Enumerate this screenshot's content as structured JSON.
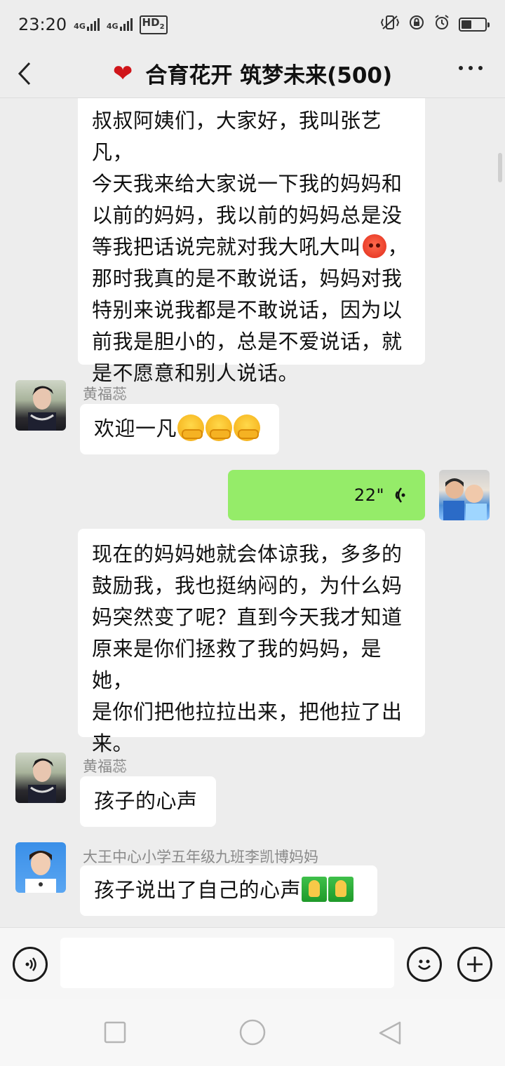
{
  "status_bar": {
    "time": "23:20",
    "network1": "4G",
    "network2": "4G",
    "hd": "HD",
    "hd_sub": "2",
    "battery_level": 0.4
  },
  "header": {
    "title": "合育花开 筑梦未来(500)",
    "heart": "❤"
  },
  "messages": {
    "m1": {
      "line1": "叔叔阿姨们，大家好，我叫张艺凡，",
      "line2": "今天我来给大家说一下我的妈妈和",
      "line3": "以前的妈妈，我以前的妈妈总是没",
      "line4a": "等我把话说完就对我大吼大叫",
      "line4b": "，",
      "line5": "那时我真的是不敢说话，妈妈对我",
      "line6": "特别来说我都是不敢说话，因为以",
      "line7": "前我是胆小的，总是不爱说话，就",
      "line8": "是不愿意和别人说话。"
    },
    "m2": {
      "sender": "黄福蕊",
      "text": "欢迎一凡"
    },
    "m3": {
      "duration": "22\""
    },
    "m4": {
      "line1": "现在的妈妈她就会体谅我，多多的",
      "line2": "鼓励我，我也挺纳闷的，为什么妈",
      "line3": "妈突然变了呢？直到今天我才知道",
      "line4": "原来是你们拯救了我的妈妈，是她，",
      "line5": "是你们把他拉拉出来，把他拉了出",
      "line6": "来。"
    },
    "m5": {
      "sender": "黄福蕊",
      "text": "孩子的心声"
    },
    "m6": {
      "sender": "大王中心小学五年级九班李凯博妈妈",
      "text": "孩子说出了自己的心声"
    }
  },
  "colors": {
    "background": "#ededed",
    "bubble_white": "#ffffff",
    "bubble_green": "#95ec69",
    "heart": "#d0151a"
  }
}
